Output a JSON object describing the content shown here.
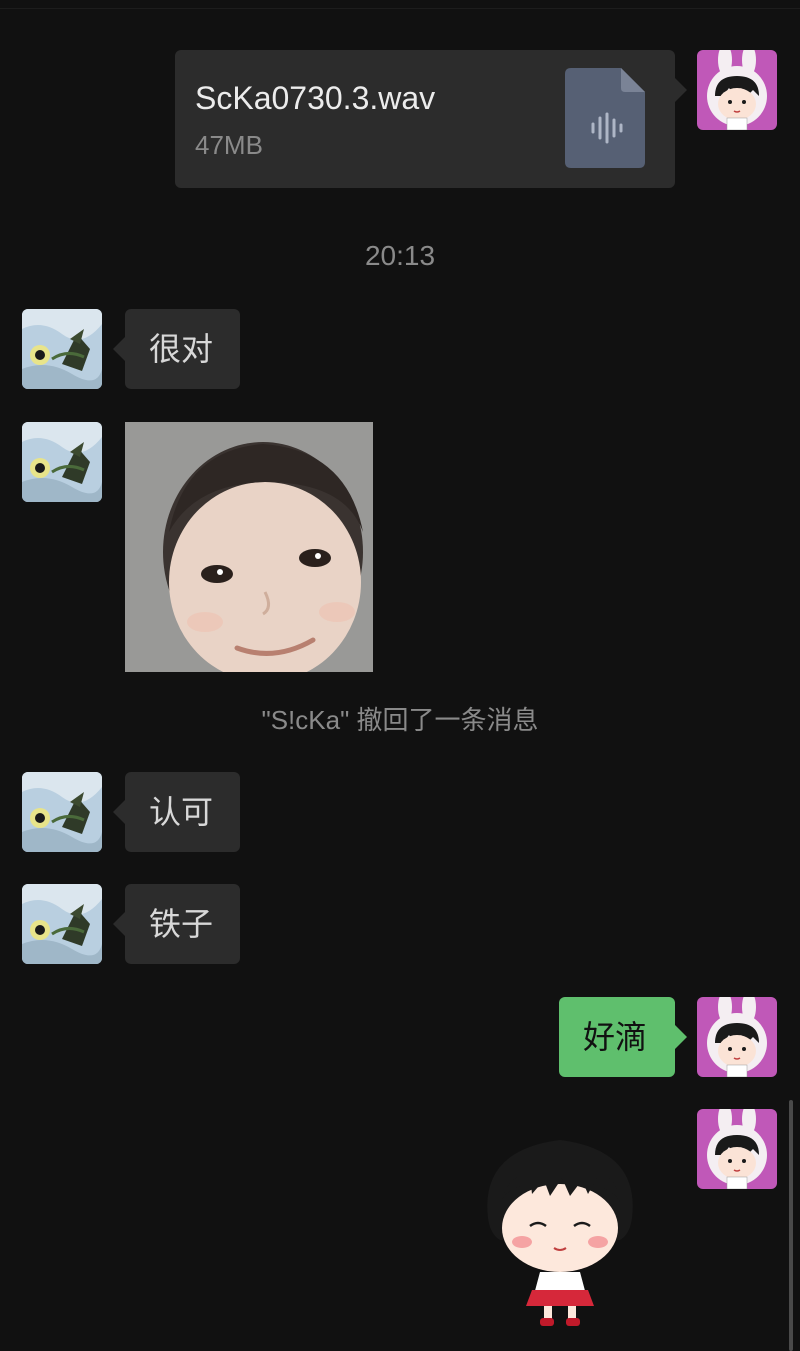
{
  "file_message": {
    "filename": "ScKa0730.3.wav",
    "size": "47MB",
    "icon": "audio-file-icon"
  },
  "timestamp": "20:13",
  "messages": [
    {
      "side": "left",
      "text": "很对"
    },
    {
      "side": "left",
      "text": "认可"
    },
    {
      "side": "left",
      "text": "铁子"
    },
    {
      "side": "right",
      "text": "好滴"
    }
  ],
  "recall_notice": "\"S!cKa\" 撤回了一条消息",
  "colors": {
    "background": "#111111",
    "bubble": "#2c2c2c",
    "bubble_self": "#5fbf6d",
    "system_text": "#8a8a8a"
  }
}
